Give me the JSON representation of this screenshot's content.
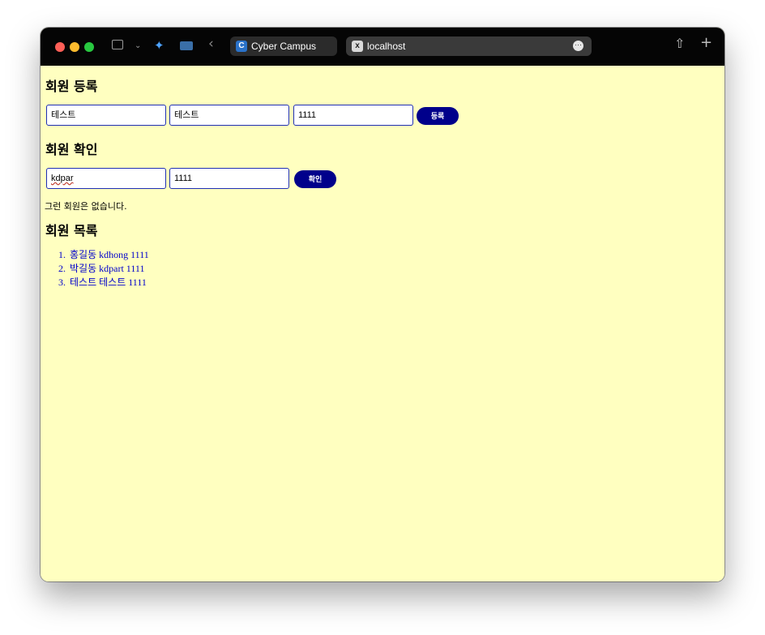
{
  "browser": {
    "tabs": [
      {
        "label": "Cyber Campus",
        "favicon": "C"
      },
      {
        "label": "localhost",
        "favicon": "x"
      }
    ]
  },
  "page": {
    "register": {
      "heading": "회원 등록",
      "field1_value": "테스트",
      "field2_value": "테스트",
      "field3_value": "1111",
      "button_label": "등록"
    },
    "verify": {
      "heading": "회원 확인",
      "id_value": "kdpar",
      "pw_value": "1111",
      "button_label": "확인",
      "result_message": "그런 회원은 없습니다."
    },
    "list": {
      "heading": "회원 목록",
      "items": [
        "홍길동 kdhong 1111",
        "박길동 kdpart 1111",
        "테스트 테스트 1111"
      ]
    }
  },
  "colors": {
    "page_background": "#ffffc0",
    "accent": "#00008b",
    "link": "#0000cc",
    "titlebar": "#050505"
  }
}
